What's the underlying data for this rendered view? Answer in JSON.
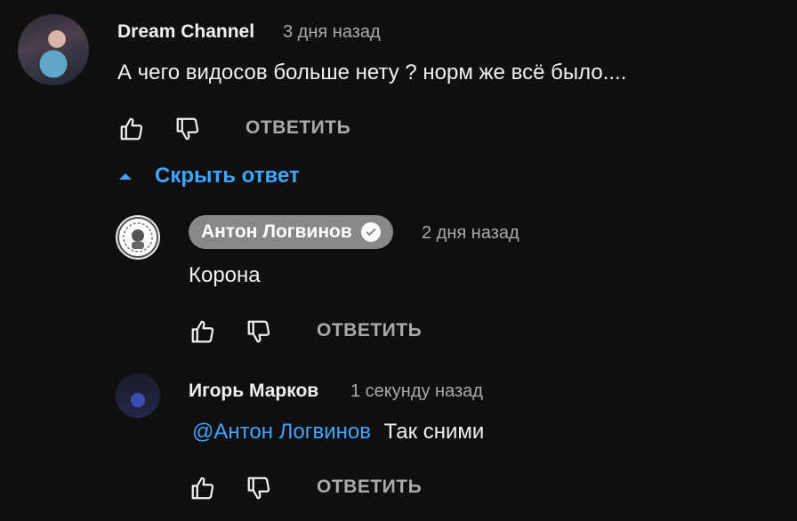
{
  "comments": {
    "top": {
      "author": "Dream Channel",
      "time": "3 дня назад",
      "text": "А чего видосов больше нету ? норм же всё было....",
      "reply_label": "ОТВЕТИТЬ"
    },
    "hide_reply_label": "Скрыть ответ",
    "replies": [
      {
        "author": "Антон Логвинов",
        "time": "2 дня назад",
        "text": "Корона",
        "reply_label": "ОТВЕТИТЬ",
        "verified": true
      },
      {
        "author": "Игорь Марков",
        "time": "1 секунду назад",
        "mention": "@Антон Логвинов",
        "text": "Так сними",
        "reply_label": "ОТВЕТИТЬ"
      }
    ]
  },
  "colors": {
    "background": "#0f0f0f",
    "link_blue": "#3ea6ff",
    "muted_text": "#aaaaaa",
    "owner_badge": "#888888"
  },
  "icons": {
    "like": "thumbs-up-icon",
    "dislike": "thumbs-down-icon",
    "collapse": "triangle-up-icon",
    "verified": "checkmark-icon"
  }
}
